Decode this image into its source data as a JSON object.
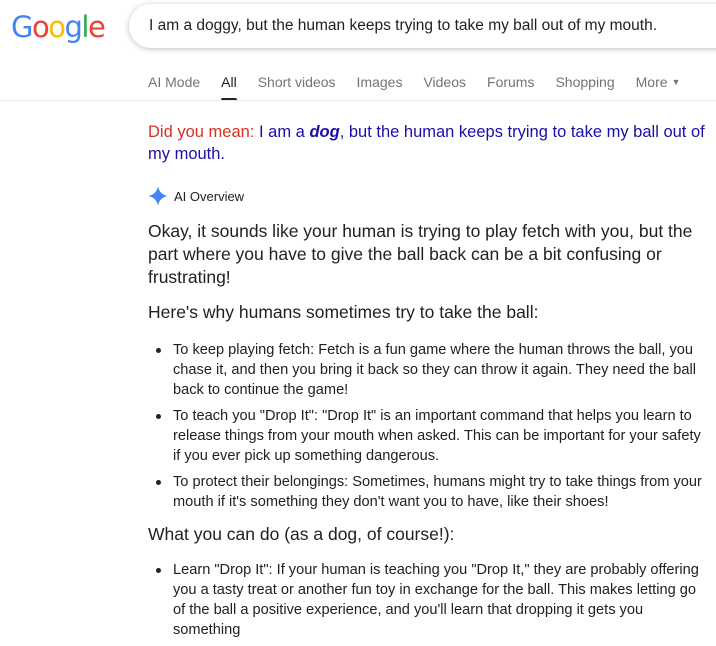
{
  "logo": {
    "letters": [
      {
        "ch": "G",
        "color": "#4285F4"
      },
      {
        "ch": "o",
        "color": "#EA4335"
      },
      {
        "ch": "o",
        "color": "#FBBC05"
      },
      {
        "ch": "g",
        "color": "#4285F4"
      },
      {
        "ch": "l",
        "color": "#34A853"
      },
      {
        "ch": "e",
        "color": "#EA4335"
      }
    ]
  },
  "search": {
    "query": "I am a doggy, but the human keeps trying to take my ball out of my mouth."
  },
  "tabs": [
    {
      "label": "AI Mode"
    },
    {
      "label": "All"
    },
    {
      "label": "Short videos"
    },
    {
      "label": "Images"
    },
    {
      "label": "Videos"
    },
    {
      "label": "Forums"
    },
    {
      "label": "Shopping"
    },
    {
      "label": "More"
    }
  ],
  "did_you_mean": {
    "label": "Did you mean:",
    "prefix": "I am a",
    "bold": "dog",
    "suffix": ", but the human keeps trying to take my ball out of my mouth."
  },
  "ai_overview": {
    "label": "AI Overview",
    "intro": "Okay, it sounds like your human is trying to play fetch with you, but the part where you have to give the ball back can be a bit confusing or frustrating!",
    "heading1": "Here's why humans sometimes try to take the ball:",
    "bullets1": [
      "To keep playing fetch: Fetch is a fun game where the human throws the ball, you chase it, and then you bring it back so they can throw it again. They need the ball back to continue the game!",
      "To teach you \"Drop It\": \"Drop It\" is an important command that helps you learn to release things from your mouth when asked. This can be important for your safety if you ever pick up something dangerous.",
      "To protect their belongings: Sometimes, humans might try to take things from your mouth if it's something they don't want you to have, like their shoes!"
    ],
    "heading2": "What you can do (as a dog, of course!):",
    "bullets2": [
      "Learn \"Drop It\": If your human is teaching you \"Drop It,\" they are probably offering you a tasty treat or another fun toy in exchange for the ball. This makes letting go of the ball a positive experience, and you'll learn that dropping it gets you something"
    ]
  }
}
